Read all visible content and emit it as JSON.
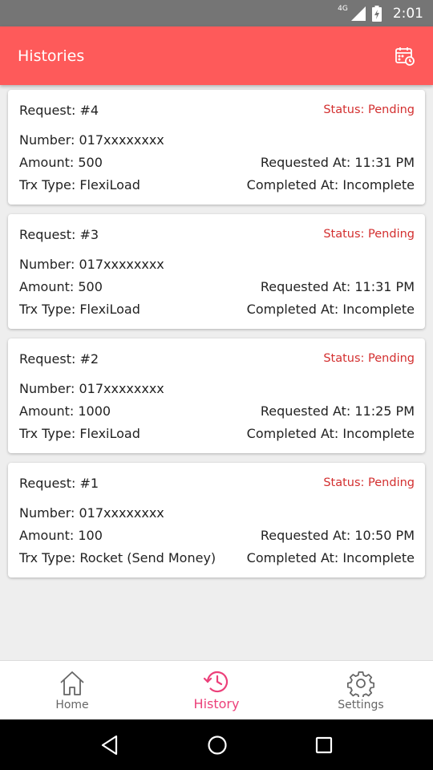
{
  "status_bar": {
    "network": "4G",
    "time": "2:01"
  },
  "app_bar": {
    "title": "Histories",
    "action_icon": "calendar-clock-icon"
  },
  "requests": [
    {
      "request": "Request: #4",
      "status": "Status: Pending",
      "number": "Number: 017xxxxxxxx",
      "amount": "Amount: 500",
      "requested_at": "Requested At: 11:31 PM",
      "trx_type": "Trx Type: FlexiLoad",
      "completed_at": "Completed At: Incomplete"
    },
    {
      "request": "Request: #3",
      "status": "Status: Pending",
      "number": "Number: 017xxxxxxxx",
      "amount": "Amount: 500",
      "requested_at": "Requested At: 11:31 PM",
      "trx_type": "Trx Type: FlexiLoad",
      "completed_at": "Completed At: Incomplete"
    },
    {
      "request": "Request: #2",
      "status": "Status: Pending",
      "number": "Number: 017xxxxxxxx",
      "amount": "Amount: 1000",
      "requested_at": "Requested At: 11:25 PM",
      "trx_type": "Trx Type: FlexiLoad",
      "completed_at": "Completed At: Incomplete"
    },
    {
      "request": "Request: #1",
      "status": "Status: Pending",
      "number": "Number: 017xxxxxxxx",
      "amount": "Amount: 100",
      "requested_at": "Requested At: 10:50 PM",
      "trx_type": "Trx Type: Rocket (Send Money)",
      "completed_at": "Completed At: Incomplete"
    }
  ],
  "bottom_nav": {
    "home": "Home",
    "history": "History",
    "settings": "Settings",
    "active": "History"
  },
  "colors": {
    "app_bar": "#fe5a5a",
    "status": "#d32f2f",
    "active_nav": "#ec407a"
  }
}
